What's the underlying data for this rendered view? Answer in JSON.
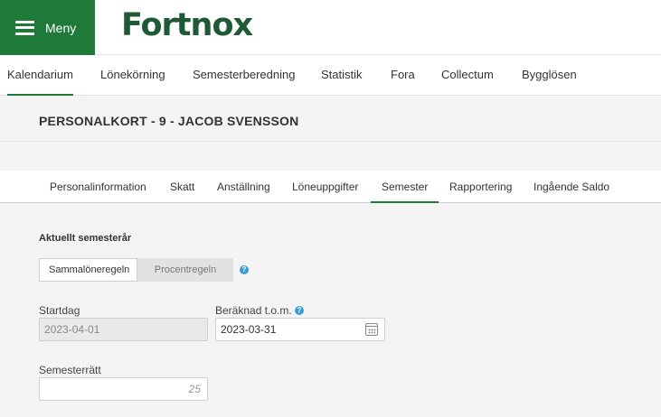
{
  "header": {
    "menu_label": "Meny",
    "logo_text": "Fortnox",
    "brand_color": "#1f7a3a"
  },
  "main_nav": {
    "items": [
      {
        "label": "Kalendarium",
        "active": true
      },
      {
        "label": "Lönekörning",
        "active": false
      },
      {
        "label": "Semesterberedning",
        "active": false
      },
      {
        "label": "Statistik",
        "active": false
      },
      {
        "label": "Fora",
        "active": false
      },
      {
        "label": "Collectum",
        "active": false
      },
      {
        "label": "Bygglösen",
        "active": false
      }
    ]
  },
  "page": {
    "title": "PERSONALKORT - 9 - JACOB SVENSSON"
  },
  "sub_tabs": {
    "items": [
      {
        "label": "Personalinformation",
        "active": false
      },
      {
        "label": "Skatt",
        "active": false
      },
      {
        "label": "Anställning",
        "active": false
      },
      {
        "label": "Löneuppgifter",
        "active": false
      },
      {
        "label": "Semester",
        "active": true
      },
      {
        "label": "Rapportering",
        "active": false
      },
      {
        "label": "Ingående Saldo",
        "active": false
      }
    ]
  },
  "semester": {
    "heading": "Aktuellt semesterår",
    "rule_options": [
      {
        "label": "Sammalöneregeln",
        "selected": true
      },
      {
        "label": "Procentregeln",
        "selected": false
      }
    ],
    "help_icon": "?",
    "startdag": {
      "label": "Startdag",
      "value": "2023-04-01",
      "disabled": true
    },
    "beraknad_tom": {
      "label": "Beräknad t.o.m.",
      "value": "2023-03-31"
    },
    "semesterratt": {
      "label": "Semesterrätt",
      "value": "25"
    }
  },
  "icons": {
    "menu": "hamburger-icon",
    "help": "help-icon",
    "calendar": "calendar-icon"
  },
  "colors": {
    "accent": "#1f7a3a",
    "logo": "#1f5a36",
    "help": "#3a9fd0"
  }
}
